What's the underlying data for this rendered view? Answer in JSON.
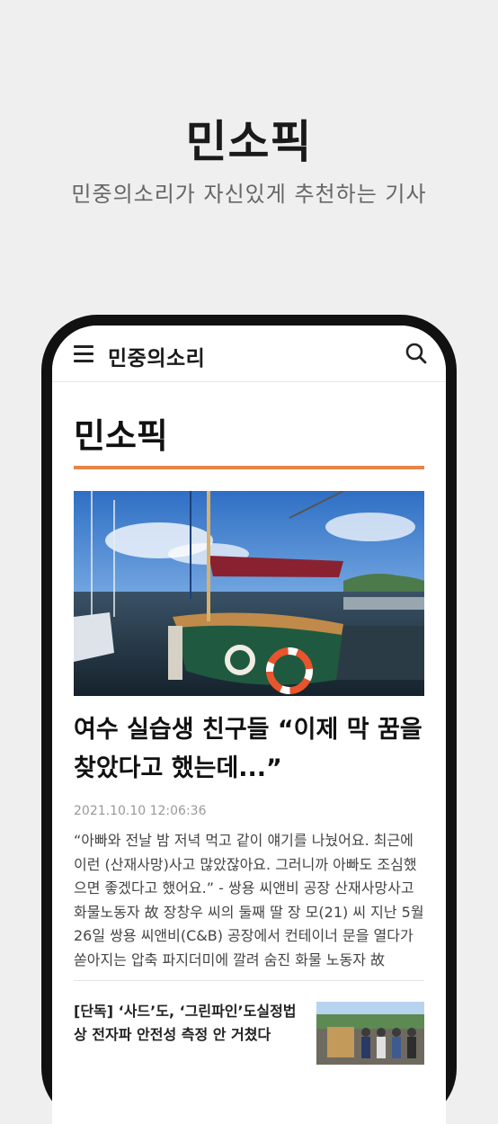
{
  "promo": {
    "title": "민소픽",
    "subtitle": "민중의소리가 자신있게 추천하는 기사"
  },
  "app": {
    "logo": "민중의소리",
    "menu_icon": "hamburger-menu-icon",
    "search_icon": "search-icon"
  },
  "section": {
    "title": "민소픽",
    "accent_color": "#e5854a"
  },
  "featured": {
    "headline_line1": "여수 실습생 친구들 “이제 막 꿈을",
    "headline_line2": "찾았다고 했는데...”",
    "timestamp": "2021.10.10 12:06:36",
    "summary": "“아빠와 전날 밤 저녁 먹고 같이 얘기를 나눴어요. 최근에 이런 (산재사망)사고 많았잖아요. 그러니까 아빠도 조심했으면 좋겠다고 했어요.” - 쌍용 씨앤비 공장 산재사망사고 화물노동자 故 장창우 씨의 둘째 딸 장 모(21) 씨 지난 5월 26일 쌍용 씨앤비(C&B) 공장에서 컨테이너 문을 열다가 쏟아지는 압축 파지더미에 깔려 숨진 화물 노동자 故"
  },
  "articles": [
    {
      "title": "[단독] ‘사드’도, ‘그린파인’도실정법상 전자파 안전성 측정 안 거쳤다"
    }
  ]
}
